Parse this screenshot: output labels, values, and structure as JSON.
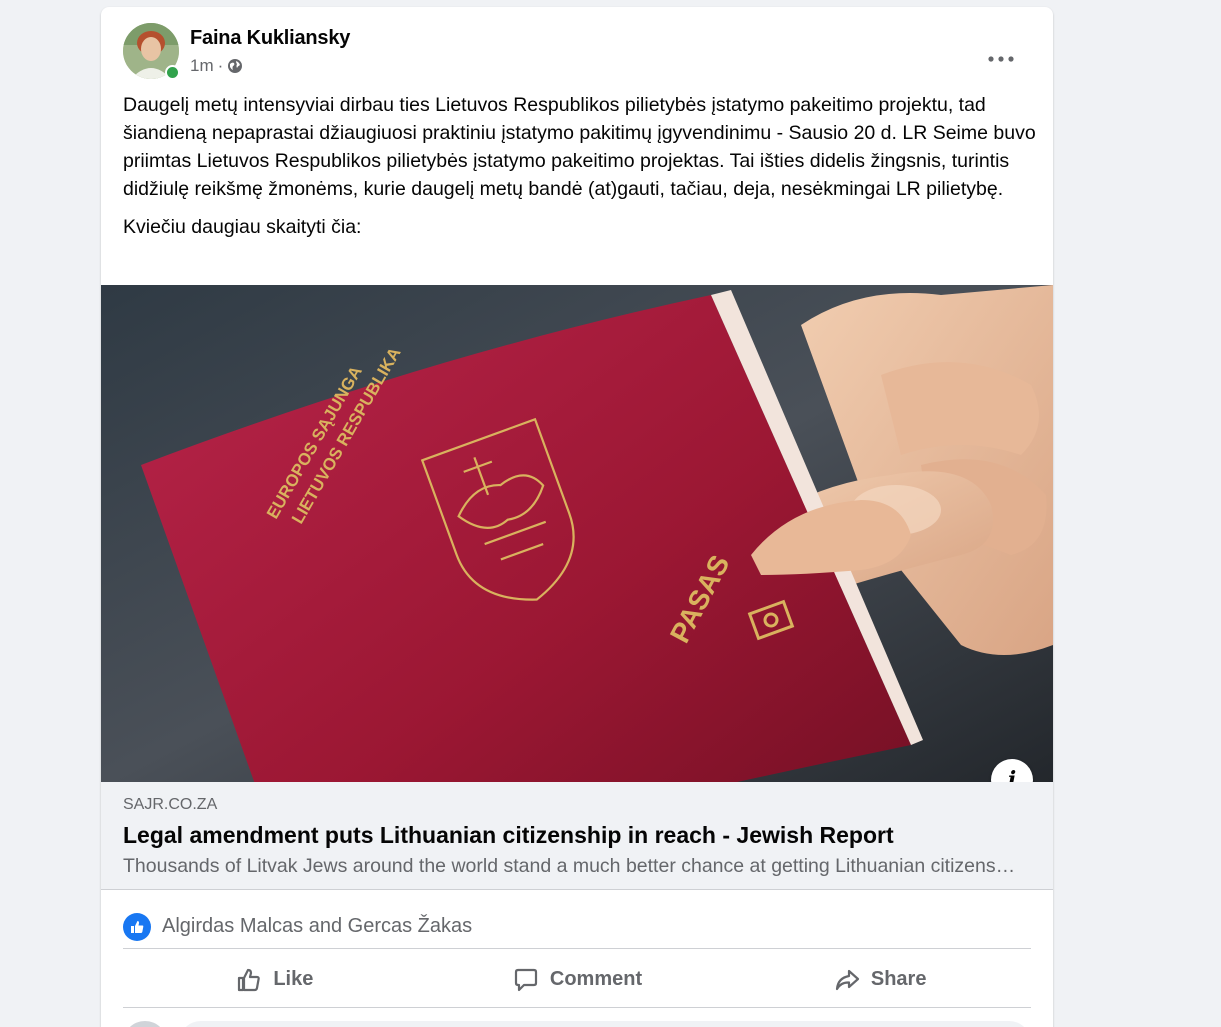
{
  "post": {
    "author": "Faina Kukliansky",
    "time": "1m",
    "separator": "·",
    "paragraph1": "Daugelį metų intensyviai dirbau ties Lietuvos Respublikos pilietybės įstatymo pakeitimo projektu, tad šiandieną nepaprastai džiaugiuosi praktiniu įstatymo pakitimų įgyvendinimu - Sausio 20 d. LR Seime buvo priimtas Lietuvos Respublikos pilietybės įstatymo pakeitimo projektas. Tai išties didelis žingsnis, turintis didžiulę reikšmę žmonėms, kurie daugelį metų bandė (at)gauti, tačiau, deja, nesėkmingai LR pilietybę.",
    "paragraph2": "Kviečiu daugiau skaityti čia:"
  },
  "link": {
    "image_text": {
      "line1": "EUROPOS SĄJUNGA",
      "line2": "LIETUVOS RESPUBLIKA",
      "pasas": "PASAS"
    },
    "info_glyph": "i",
    "domain": "SAJR.CO.ZA",
    "title": "Legal amendment puts Lithuanian citizenship in reach - Jewish Report",
    "description": "Thousands of Litvak Jews around the world stand a much better chance at getting Lithuanian citizenship now"
  },
  "reactions": {
    "names": "Algirdas Malcas and Gercas Žakas"
  },
  "actions": {
    "like": "Like",
    "comment": "Comment",
    "share": "Share"
  },
  "colors": {
    "accent": "#1877f2",
    "online": "#31a24c",
    "secondary_text": "#65676b",
    "passport": "#9b1733"
  },
  "icons": [
    "more-icon",
    "globe-icon",
    "info-icon",
    "like-icon",
    "comment-icon",
    "share-icon"
  ]
}
